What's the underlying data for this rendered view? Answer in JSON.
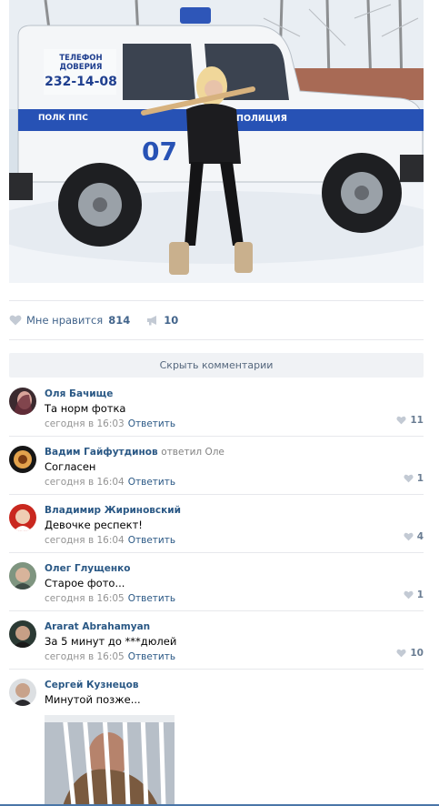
{
  "photo": {
    "phone_label": "ТЕЛЕФОН",
    "phone_label2": "ДОВЕРИЯ",
    "phone_number": "232-14-08",
    "stripe_left": "ПОЛК ППС",
    "stripe_right": "ПОЛИЦИЯ",
    "car_number": "07"
  },
  "actions": {
    "like_label": "Мне нравится",
    "like_count": "814",
    "share_count": "10"
  },
  "hide_comments_label": "Скрыть комментарии",
  "comments": [
    {
      "author": "Оля Бачище",
      "reply_to": "",
      "text": "Та норм фотка",
      "time": "сегодня в 16:03",
      "reply": "Ответить",
      "likes": "11"
    },
    {
      "author": "Вадим Гайфутдинов",
      "reply_to": "ответил Оле",
      "text": "Согласен",
      "time": "сегодня в 16:04",
      "reply": "Ответить",
      "likes": "1"
    },
    {
      "author": "Владимир Жириновский",
      "reply_to": "",
      "text": "Девочке респект!",
      "time": "сегодня в 16:04",
      "reply": "Ответить",
      "likes": "4"
    },
    {
      "author": "Олег Глущенко",
      "reply_to": "",
      "text": "Старое фото...",
      "time": "сегодня в 16:05",
      "reply": "Ответить",
      "likes": "1"
    },
    {
      "author": "Ararat Abrahamyan",
      "reply_to": "",
      "text": "За 5 минут до ***дюлей",
      "time": "сегодня в 16:05",
      "reply": "Ответить",
      "likes": "10"
    },
    {
      "author": "Сергей Кузнецов",
      "reply_to": "",
      "text": "Минутой позже...",
      "time": "",
      "reply": "",
      "likes": ""
    }
  ],
  "colors": {
    "link": "#2a5885",
    "accent": "#4a76a8",
    "divider": "#e7e8ec",
    "button_bg": "#f0f2f5"
  }
}
